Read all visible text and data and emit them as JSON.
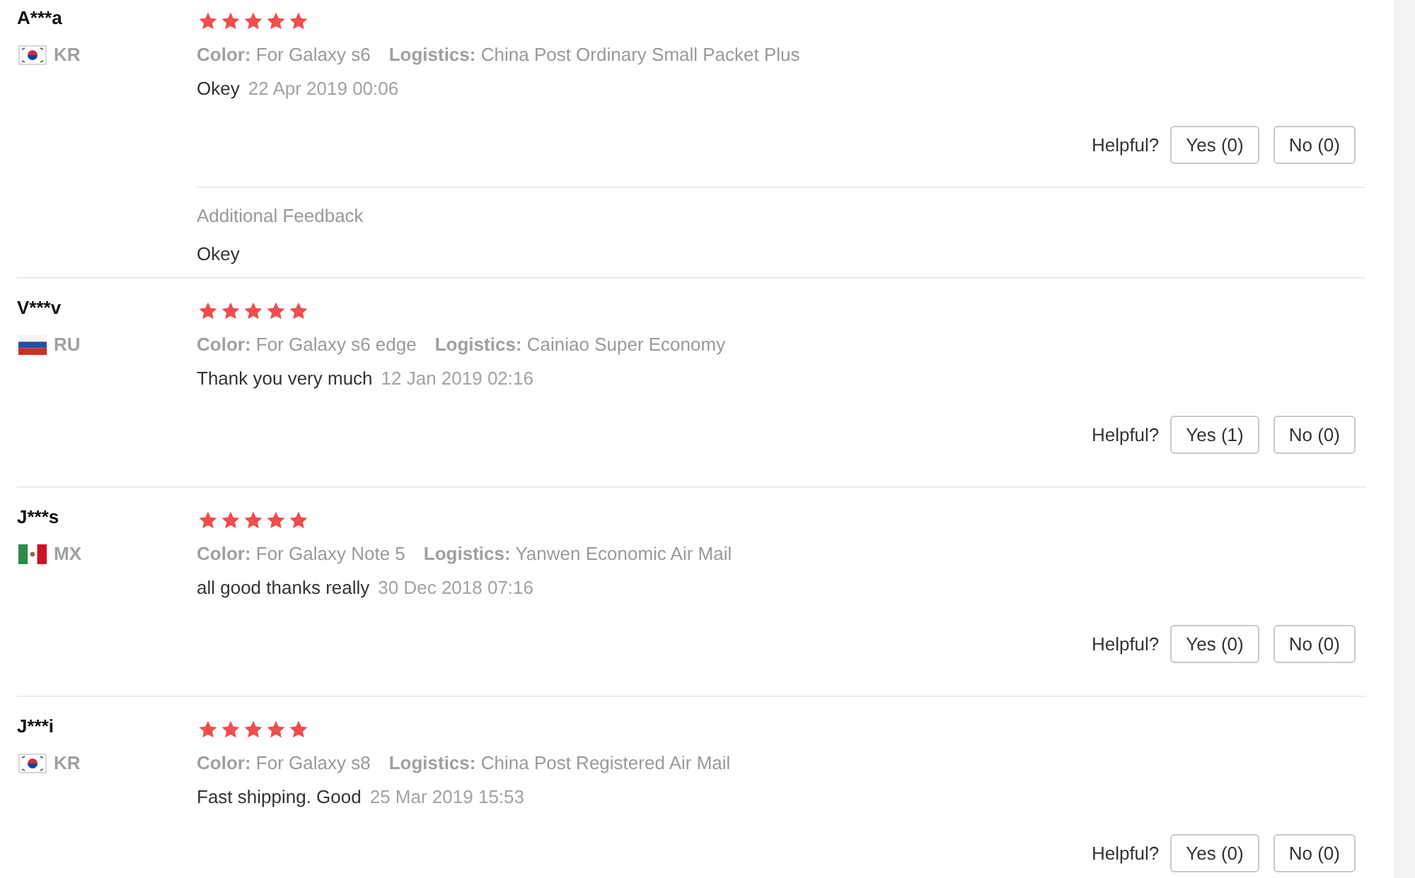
{
  "reviews": [
    {
      "author": "A***a",
      "flag": {
        "kind": "kr"
      },
      "country": "KR",
      "stars": 5,
      "details": [
        {
          "label": "Color:",
          "value": "For Galaxy s6"
        },
        {
          "label": "Logistics:",
          "value": "China Post Ordinary Small Packet Plus"
        }
      ],
      "text": "Okey",
      "date": "22 Apr 2019 00:06",
      "helpful": {
        "label": "Helpful?",
        "buttons": [
          "Yes (0)",
          "No (0)"
        ]
      },
      "additional_feedback": {
        "title": "Additional Feedback",
        "text": "Okey"
      }
    },
    {
      "author": "V***v",
      "flag": {
        "kind": "ru"
      },
      "country": "RU",
      "stars": 5,
      "details": [
        {
          "label": "Color:",
          "value": "For Galaxy s6 edge"
        },
        {
          "label": "Logistics:",
          "value": "Cainiao Super Economy"
        }
      ],
      "text": "Thank you very much",
      "date": "12 Jan 2019 02:16",
      "helpful": {
        "label": "Helpful?",
        "buttons": [
          "Yes (1)",
          "No (0)"
        ]
      }
    },
    {
      "author": "J***s",
      "flag": {
        "kind": "mx"
      },
      "country": "MX",
      "stars": 5,
      "details": [
        {
          "label": "Color:",
          "value": "For Galaxy Note 5"
        },
        {
          "label": "Logistics:",
          "value": "Yanwen Economic Air Mail"
        }
      ],
      "text": "all good thanks really",
      "date": "30 Dec 2018 07:16",
      "helpful": {
        "label": "Helpful?",
        "buttons": [
          "Yes (0)",
          "No (0)"
        ]
      }
    },
    {
      "author": "J***i",
      "flag": {
        "kind": "kr"
      },
      "country": "KR",
      "stars": 5,
      "details": [
        {
          "label": "Color:",
          "value": "For Galaxy s8"
        },
        {
          "label": "Logistics:",
          "value": "China Post Registered Air Mail"
        }
      ],
      "text": "Fast shipping. Good",
      "date": "25 Mar 2019 15:53",
      "helpful": {
        "label": "Helpful?",
        "buttons": [
          "Yes (0)",
          "No (0)"
        ]
      }
    }
  ]
}
